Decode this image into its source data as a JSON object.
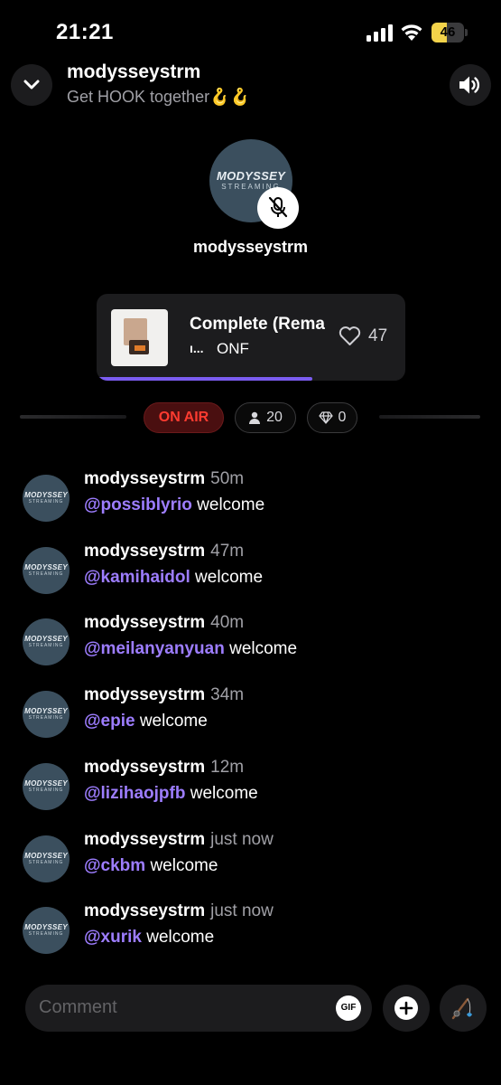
{
  "status_bar": {
    "time": "21:21",
    "battery_level": "46",
    "battery_fraction": 0.46,
    "icons": [
      "signal-icon",
      "wifi-icon",
      "battery-icon"
    ]
  },
  "header": {
    "title": "modysseystrm",
    "subtitle": "Get HOOK together🪝🪝",
    "icons": [
      "chevron-down-icon",
      "speaker-icon"
    ]
  },
  "host": {
    "logo_main": "MODYSSEY",
    "logo_sub": "STREAMING",
    "name": "modysseystrm",
    "mic_state": "muted"
  },
  "now_playing": {
    "title": "Complete (Rema",
    "prefix": "ı...",
    "artist": "ONF",
    "likes": "47",
    "progress_fraction": 0.7
  },
  "stats": {
    "on_air": "ON AIR",
    "listeners": "20",
    "gems": "0"
  },
  "chat": [
    {
      "user": "modysseystrm",
      "time": "50m",
      "mention": "@possiblyrio",
      "text": " welcome"
    },
    {
      "user": "modysseystrm",
      "time": "47m",
      "mention": "@kamihaidol",
      "text": " welcome"
    },
    {
      "user": "modysseystrm",
      "time": "40m",
      "mention": "@meilanyanyuan",
      "text": " welcome"
    },
    {
      "user": "modysseystrm",
      "time": "34m",
      "mention": "@epie",
      "text": " welcome"
    },
    {
      "user": "modysseystrm",
      "time": "12m",
      "mention": "@lizihaojpfb",
      "text": " welcome"
    },
    {
      "user": "modysseystrm",
      "time": "just now",
      "mention": "@ckbm",
      "text": " welcome"
    },
    {
      "user": "modysseystrm",
      "time": "just now",
      "mention": "@xurik",
      "text": " welcome"
    }
  ],
  "composer": {
    "placeholder": "Comment",
    "gif_label": "GIF"
  },
  "colors": {
    "accent": "#9d7dff",
    "on_air": "#ff3b30",
    "battery": "#f3d34a"
  }
}
